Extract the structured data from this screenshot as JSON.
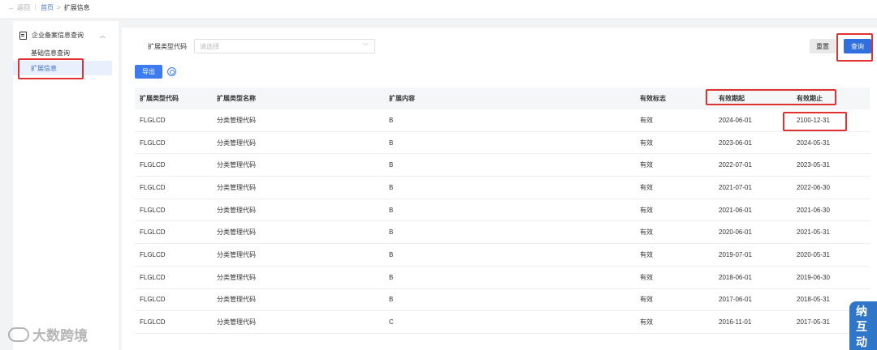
{
  "topbar": {
    "back_label": "返回",
    "crumb_home": "首页",
    "crumb_sep": ">",
    "crumb_current": "扩展信息"
  },
  "sidebar": {
    "group_label": "企业备案信息查询",
    "items": [
      {
        "label": "基础信息查询"
      },
      {
        "label": "扩展信息"
      }
    ]
  },
  "filter": {
    "label": "扩展类型代码",
    "placeholder": "请选择"
  },
  "buttons": {
    "reset": "重置",
    "query": "查询",
    "export": "导出"
  },
  "table": {
    "headers": [
      "扩展类型代码",
      "扩展类型名称",
      "扩展内容",
      "有效标志",
      "有效期起",
      "有效期止"
    ],
    "rows": [
      [
        "FLGLCD",
        "分类管理代码",
        "B",
        "有效",
        "2024-06-01",
        "2100-12-31"
      ],
      [
        "FLGLCD",
        "分类管理代码",
        "B",
        "有效",
        "2023-06-01",
        "2024-05-31"
      ],
      [
        "FLGLCD",
        "分类管理代码",
        "B",
        "有效",
        "2022-07-01",
        "2023-05-31"
      ],
      [
        "FLGLCD",
        "分类管理代码",
        "B",
        "有效",
        "2021-07-01",
        "2022-06-30"
      ],
      [
        "FLGLCD",
        "分类管理代码",
        "B",
        "有效",
        "2021-06-01",
        "2021-06-30"
      ],
      [
        "FLGLCD",
        "分类管理代码",
        "B",
        "有效",
        "2020-06-01",
        "2021-05-31"
      ],
      [
        "FLGLCD",
        "分类管理代码",
        "B",
        "有效",
        "2019-07-01",
        "2020-05-31"
      ],
      [
        "FLGLCD",
        "分类管理代码",
        "B",
        "有效",
        "2018-06-01",
        "2019-06-30"
      ],
      [
        "FLGLCD",
        "分类管理代码",
        "B",
        "有效",
        "2017-06-01",
        "2018-05-31"
      ],
      [
        "FLGLCD",
        "分类管理代码",
        "C",
        "有效",
        "2016-11-01",
        "2017-05-31"
      ]
    ]
  },
  "watermark": {
    "text": "大数跨境"
  },
  "corner_badge": {
    "text": "纳互动"
  },
  "colors": {
    "primary": "#2f6fe0",
    "highlight_box": "#e03131",
    "active_bg": "#e8f0fe"
  }
}
